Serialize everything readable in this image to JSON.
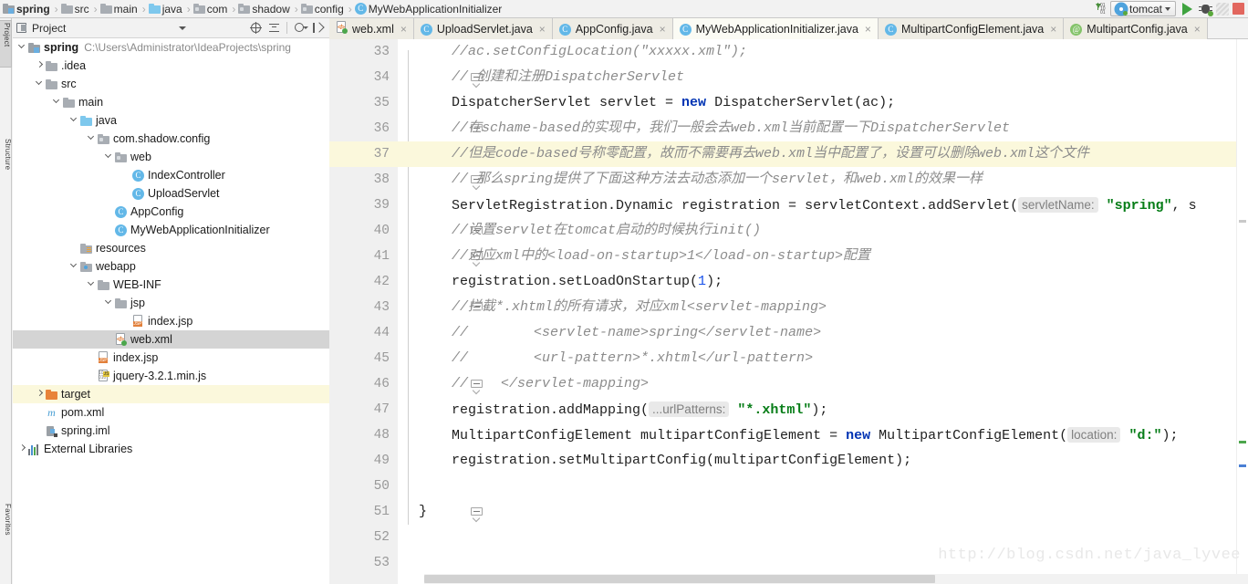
{
  "navbar": {
    "crumbs": [
      {
        "label": "spring",
        "icon": "module-icon",
        "bold": true
      },
      {
        "label": "src",
        "icon": "folder-icon",
        "bold": false
      },
      {
        "label": "main",
        "icon": "folder-icon",
        "bold": false
      },
      {
        "label": "java",
        "icon": "source-folder-icon",
        "bold": false
      },
      {
        "label": "com",
        "icon": "package-icon",
        "bold": false
      },
      {
        "label": "shadow",
        "icon": "package-icon",
        "bold": false
      },
      {
        "label": "config",
        "icon": "package-icon",
        "bold": false
      },
      {
        "label": "MyWebApplicationInitializer",
        "icon": "java-class-icon",
        "bold": false
      }
    ],
    "separator": "›",
    "run": {
      "sort_icon": "sort-numeric-icon",
      "config_name": "tomcat",
      "config_icon": "tomcat-gear-icon",
      "dropdown_icon": "chevron-down-icon",
      "run_icon": "run-play-icon",
      "debug_icon": "debug-bug-icon",
      "coverage_icon": "run-coverage-icon",
      "stop_icon": "stop-square-icon"
    }
  },
  "left_strip": {
    "tabs": [
      {
        "label": "Project",
        "selected": true
      },
      {
        "label": "Structure",
        "selected": false
      },
      {
        "label": "Favorites",
        "selected": false
      }
    ]
  },
  "project_panel": {
    "title": "Project",
    "icons": {
      "panel": "project-window-icon",
      "dropdown": "chevron-down-icon",
      "locate": "scroll-from-source-icon",
      "collapse": "collapse-all-icon",
      "settings": "gear-dropdown-icon",
      "hide": "hide-window-icon"
    },
    "tree": [
      {
        "depth": 0,
        "twisty": "down",
        "icon": "module-icon",
        "label": "spring",
        "bold": true,
        "path": "C:\\Users\\Administrator\\IdeaProjects\\spring"
      },
      {
        "depth": 1,
        "twisty": "right",
        "icon": "folder-icon",
        "label": ".idea"
      },
      {
        "depth": 1,
        "twisty": "down",
        "icon": "folder-icon",
        "label": "src"
      },
      {
        "depth": 2,
        "twisty": "down",
        "icon": "folder-icon",
        "label": "main"
      },
      {
        "depth": 3,
        "twisty": "down",
        "icon": "source-folder-icon",
        "label": "java"
      },
      {
        "depth": 4,
        "twisty": "down",
        "icon": "package-icon",
        "label": "com.shadow.config"
      },
      {
        "depth": 5,
        "twisty": "down",
        "icon": "package-icon",
        "label": "web"
      },
      {
        "depth": 6,
        "twisty": "none",
        "icon": "java-class-icon",
        "label": "IndexController"
      },
      {
        "depth": 6,
        "twisty": "none",
        "icon": "java-class-icon",
        "label": "UploadServlet"
      },
      {
        "depth": 5,
        "twisty": "none",
        "icon": "java-class-icon",
        "label": "AppConfig"
      },
      {
        "depth": 5,
        "twisty": "none",
        "icon": "java-class-icon",
        "label": "MyWebApplicationInitializer"
      },
      {
        "depth": 3,
        "twisty": "none",
        "icon": "resources-folder-icon",
        "label": "resources"
      },
      {
        "depth": 3,
        "twisty": "down",
        "icon": "webapp-folder-icon",
        "label": "webapp"
      },
      {
        "depth": 4,
        "twisty": "down",
        "icon": "folder-icon",
        "label": "WEB-INF"
      },
      {
        "depth": 5,
        "twisty": "down",
        "icon": "folder-icon",
        "label": "jsp"
      },
      {
        "depth": 6,
        "twisty": "none",
        "icon": "jsp-file-icon",
        "label": "index.jsp"
      },
      {
        "depth": 5,
        "twisty": "none",
        "icon": "xml-file-icon",
        "label": "web.xml",
        "selected": true
      },
      {
        "depth": 4,
        "twisty": "none",
        "icon": "jsp-file-icon",
        "label": "index.jsp"
      },
      {
        "depth": 4,
        "twisty": "none",
        "icon": "js-file-icon",
        "label": "jquery-3.2.1.min.js"
      },
      {
        "depth": 1,
        "twisty": "right",
        "icon": "target-folder-icon",
        "label": "target",
        "highlighted": true
      },
      {
        "depth": 1,
        "twisty": "none",
        "icon": "maven-pom-icon",
        "label": "pom.xml"
      },
      {
        "depth": 1,
        "twisty": "none",
        "icon": "iml-file-icon",
        "label": "spring.iml"
      },
      {
        "depth": 0,
        "twisty": "right",
        "icon": "libraries-icon",
        "label": "External Libraries"
      }
    ]
  },
  "editor": {
    "tabs": [
      {
        "label": "web.xml",
        "icon": "xml-file-icon",
        "active": false,
        "closable": true
      },
      {
        "label": "UploadServlet.java",
        "icon": "java-class-icon",
        "active": false,
        "closable": true
      },
      {
        "label": "AppConfig.java",
        "icon": "java-class-icon",
        "active": false,
        "closable": true
      },
      {
        "label": "MyWebApplicationInitializer.java",
        "icon": "java-class-icon",
        "active": true,
        "closable": true
      },
      {
        "label": "MultipartConfigElement.java",
        "icon": "java-class-readonly-icon",
        "active": false,
        "closable": true
      },
      {
        "label": "MultipartConfig.java",
        "icon": "java-annotation-readonly-icon",
        "active": false,
        "closable": true
      }
    ],
    "close_glyph": "×",
    "caret_line": 37,
    "watermark": "http://blog.csdn.net/java_lyvee",
    "lines": [
      {
        "n": 33,
        "fold": "none",
        "tokens": [
          {
            "t": "comment",
            "v": "//ac.setConfigLocation(\"xxxxx.xml\");"
          }
        ]
      },
      {
        "n": 34,
        "fold": "end",
        "tokens": [
          {
            "t": "comment",
            "v": "// 创建和注册DispatcherServlet"
          }
        ]
      },
      {
        "n": 35,
        "fold": "none",
        "tokens": [
          {
            "t": "plain",
            "v": "DispatcherServlet servlet = "
          },
          {
            "t": "keyword",
            "v": "new"
          },
          {
            "t": "plain",
            "v": " DispatcherServlet(ac);"
          }
        ]
      },
      {
        "n": 36,
        "fold": "start",
        "tokens": [
          {
            "t": "comment",
            "v": "//在schame-based的实现中，我们一般会去web.xml当前配置一下DispatcherServlet"
          }
        ]
      },
      {
        "n": 37,
        "fold": "none",
        "tokens": [
          {
            "t": "comment",
            "v": "//但是code-based号称零配置，故而不需要再去web.xml当中配置了，设置可以删除web.xml这个文件"
          }
        ]
      },
      {
        "n": 38,
        "fold": "end",
        "tokens": [
          {
            "t": "comment",
            "v": "// 那么spring提供了下面这种方法去动态添加一个servlet，和web.xml的效果一样"
          }
        ]
      },
      {
        "n": 39,
        "fold": "none",
        "tokens": [
          {
            "t": "plain",
            "v": "ServletRegistration.Dynamic registration = servletContext.addServlet("
          },
          {
            "t": "hint",
            "v": "servletName:"
          },
          {
            "t": "plain",
            "v": " "
          },
          {
            "t": "string",
            "v": "\"spring\""
          },
          {
            "t": "plain",
            "v": ", s"
          }
        ]
      },
      {
        "n": 40,
        "fold": "start",
        "tokens": [
          {
            "t": "comment",
            "v": "//设置servlet在tomcat启动的时候执行init()"
          }
        ]
      },
      {
        "n": 41,
        "fold": "end",
        "tokens": [
          {
            "t": "comment",
            "v": "//对应xml中的<load-on-startup>1</load-on-startup>配置"
          }
        ]
      },
      {
        "n": 42,
        "fold": "none",
        "tokens": [
          {
            "t": "plain",
            "v": "registration.setLoadOnStartup("
          },
          {
            "t": "number",
            "v": "1"
          },
          {
            "t": "plain",
            "v": ");"
          }
        ]
      },
      {
        "n": 43,
        "fold": "start",
        "tokens": [
          {
            "t": "comment",
            "v": "//拦截*.xhtml的所有请求，对应xml<servlet-mapping>"
          }
        ]
      },
      {
        "n": 44,
        "fold": "none",
        "tokens": [
          {
            "t": "comment",
            "v": "//        <servlet-name>spring</servlet-name>"
          }
        ]
      },
      {
        "n": 45,
        "fold": "none",
        "tokens": [
          {
            "t": "comment",
            "v": "//        <url-pattern>*.xhtml</url-pattern>"
          }
        ]
      },
      {
        "n": 46,
        "fold": "end",
        "tokens": [
          {
            "t": "comment",
            "v": "//    </servlet-mapping>"
          }
        ]
      },
      {
        "n": 47,
        "fold": "none",
        "tokens": [
          {
            "t": "plain",
            "v": "registration.addMapping("
          },
          {
            "t": "hint",
            "v": "...urlPatterns:"
          },
          {
            "t": "plain",
            "v": " "
          },
          {
            "t": "string",
            "v": "\"*.xhtml\""
          },
          {
            "t": "plain",
            "v": ");"
          }
        ]
      },
      {
        "n": 48,
        "fold": "none",
        "tokens": [
          {
            "t": "plain",
            "v": "MultipartConfigElement multipartConfigElement = "
          },
          {
            "t": "keyword",
            "v": "new"
          },
          {
            "t": "plain",
            "v": " MultipartConfigElement("
          },
          {
            "t": "hint",
            "v": "location:"
          },
          {
            "t": "plain",
            "v": " "
          },
          {
            "t": "string",
            "v": "\"d:\""
          },
          {
            "t": "plain",
            "v": ");"
          }
        ]
      },
      {
        "n": 49,
        "fold": "none",
        "tokens": [
          {
            "t": "plain",
            "v": "registration.setMultipartConfig(multipartConfigElement);"
          }
        ]
      },
      {
        "n": 50,
        "fold": "none",
        "tokens": []
      },
      {
        "n": 51,
        "fold": "end",
        "tokens": [
          {
            "t": "plain",
            "v": "}"
          }
        ],
        "outdent": true
      },
      {
        "n": 52,
        "fold": "none",
        "tokens": []
      },
      {
        "n": 53,
        "fold": "none",
        "tokens": []
      }
    ]
  },
  "colors": {
    "accent": "#4fa3dd",
    "string": "#067d17",
    "keyword": "#0033b3",
    "comment": "#8c8c8c",
    "caret_line": "#fbf8dc",
    "selection": "#d4d4d4"
  }
}
